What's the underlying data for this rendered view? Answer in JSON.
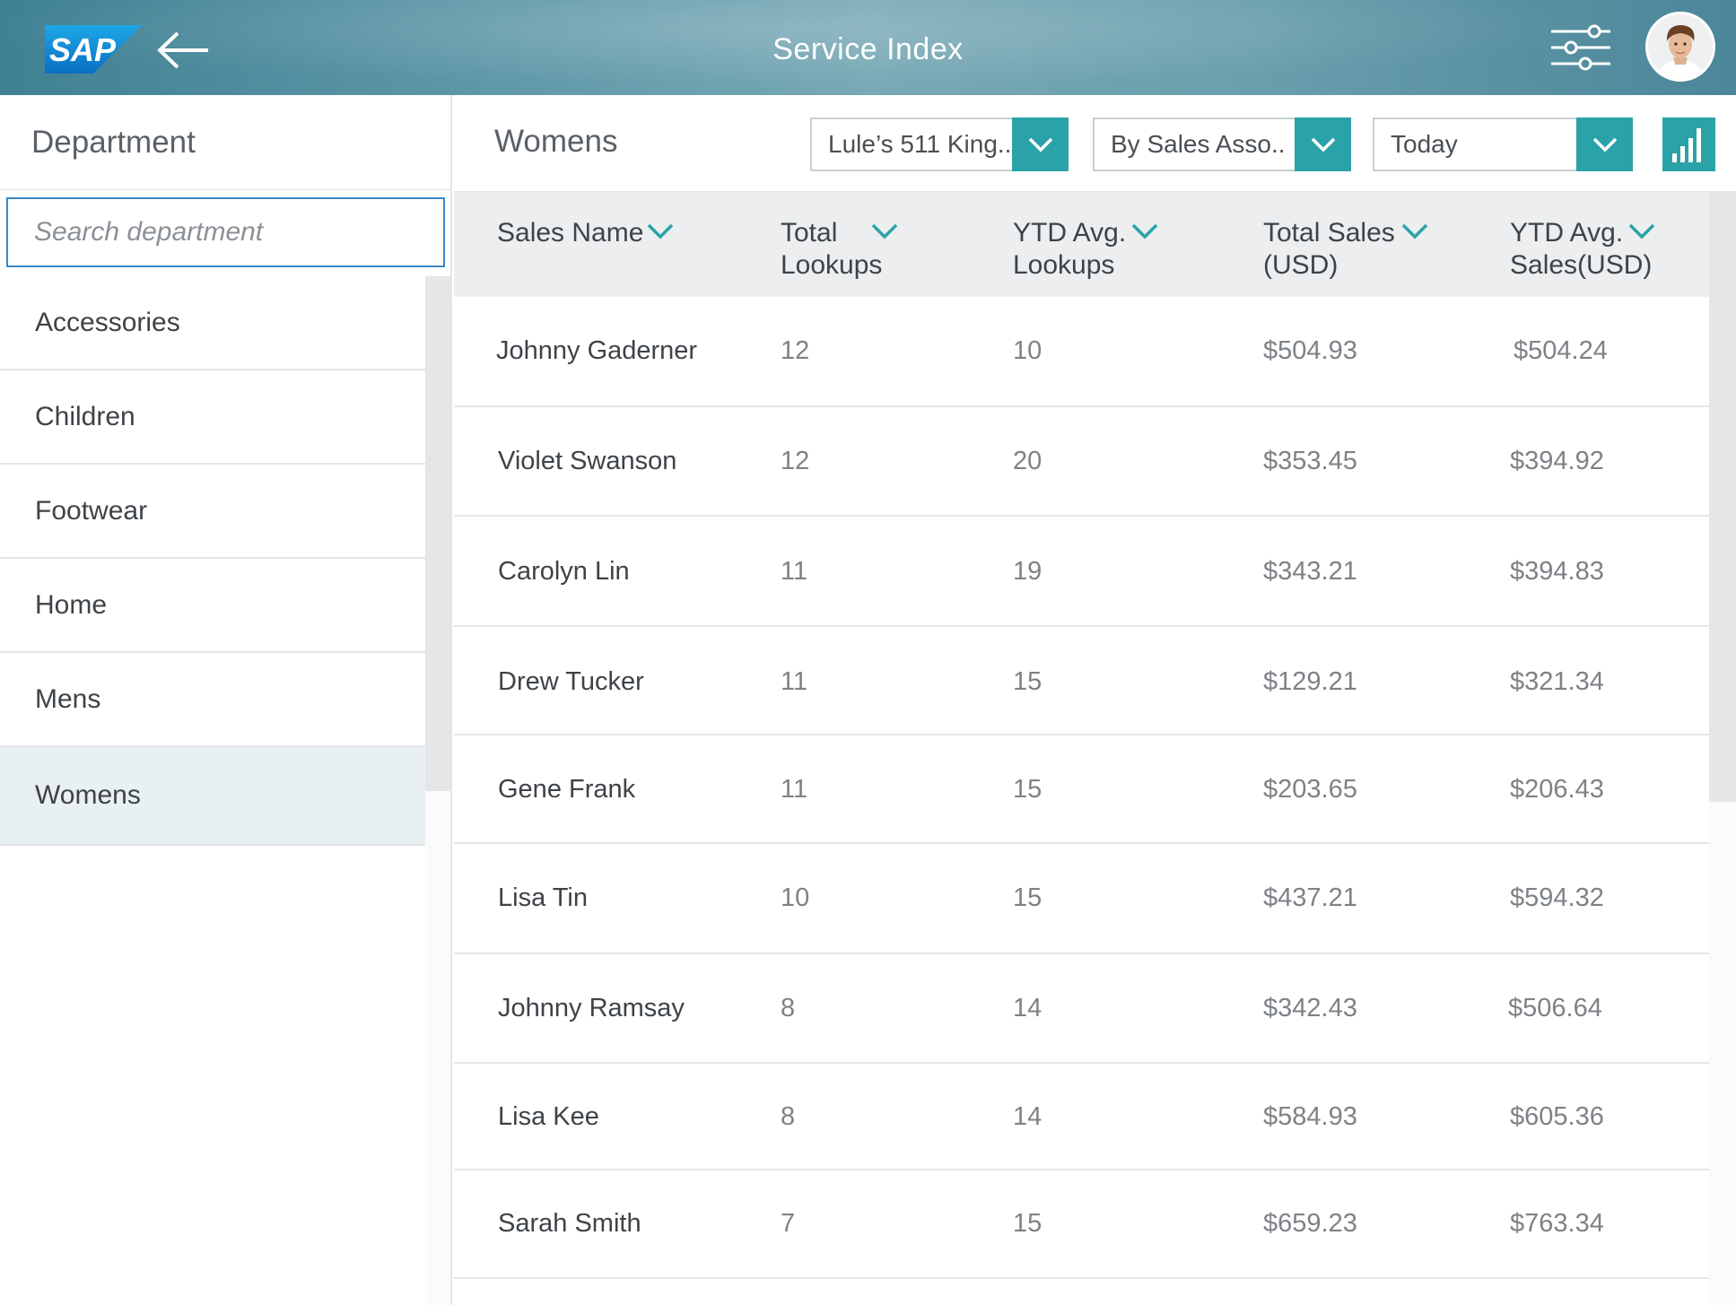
{
  "header": {
    "logo_text": "SAP",
    "title": "Service Index",
    "back_icon": "arrow-left-icon",
    "settings_icon": "sliders-icon",
    "avatar_icon": "user-avatar"
  },
  "sidebar": {
    "title": "Department",
    "search": {
      "placeholder": "Search department",
      "value": ""
    },
    "items": [
      {
        "label": "Accessories",
        "selected": false
      },
      {
        "label": "Children",
        "selected": false
      },
      {
        "label": "Footwear",
        "selected": false
      },
      {
        "label": "Home",
        "selected": false
      },
      {
        "label": "Mens",
        "selected": false
      },
      {
        "label": "Womens",
        "selected": true
      }
    ]
  },
  "main": {
    "title": "Womens",
    "filters": [
      {
        "label": "Lule’s 511 King.."
      },
      {
        "label": "By Sales Asso.."
      },
      {
        "label": "Today"
      }
    ],
    "chart_button_icon": "bar-chart-icon",
    "accent_color": "#2aa3a8",
    "table": {
      "columns": [
        {
          "line1": "Sales Name",
          "line2": ""
        },
        {
          "line1": "Total",
          "line2": "Lookups"
        },
        {
          "line1": "YTD Avg.",
          "line2": "Lookups"
        },
        {
          "line1": "Total Sales",
          "line2": "(USD)"
        },
        {
          "line1": "YTD Avg.",
          "line2": "Sales(USD)"
        }
      ],
      "rows": [
        {
          "name": "Johnny Gaderner",
          "total_lookups": "12",
          "ytd_lookups": "10",
          "total_sales": "$504.93",
          "ytd_sales": "$504.24"
        },
        {
          "name": "Violet Swanson",
          "total_lookups": "12",
          "ytd_lookups": "20",
          "total_sales": "$353.45",
          "ytd_sales": "$394.92"
        },
        {
          "name": "Carolyn Lin",
          "total_lookups": "11",
          "ytd_lookups": "19",
          "total_sales": "$343.21",
          "ytd_sales": "$394.83"
        },
        {
          "name": "Drew Tucker",
          "total_lookups": "11",
          "ytd_lookups": "15",
          "total_sales": "$129.21",
          "ytd_sales": "$321.34"
        },
        {
          "name": "Gene Frank",
          "total_lookups": "11",
          "ytd_lookups": "15",
          "total_sales": "$203.65",
          "ytd_sales": "$206.43"
        },
        {
          "name": "Lisa Tin",
          "total_lookups": "10",
          "ytd_lookups": "15",
          "total_sales": "$437.21",
          "ytd_sales": "$594.32"
        },
        {
          "name": "Johnny Ramsay",
          "total_lookups": "8",
          "ytd_lookups": "14",
          "total_sales": "$342.43",
          "ytd_sales": "$506.64"
        },
        {
          "name": "Lisa Kee",
          "total_lookups": "8",
          "ytd_lookups": "14",
          "total_sales": "$584.93",
          "ytd_sales": "$605.36"
        },
        {
          "name": "Sarah Smith",
          "total_lookups": "7",
          "ytd_lookups": "15",
          "total_sales": "$659.23",
          "ytd_sales": "$763.34"
        }
      ]
    }
  }
}
